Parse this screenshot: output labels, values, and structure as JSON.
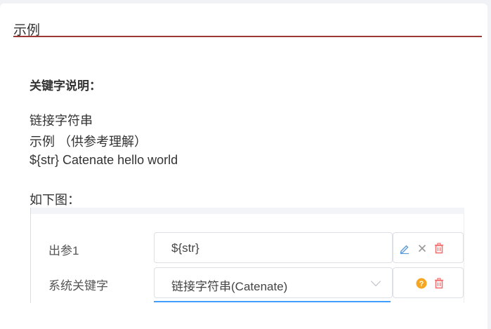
{
  "section": {
    "title": "示例"
  },
  "content": {
    "heading": "关键字说明：",
    "lines": [
      "链接字符串",
      "示例 （供参考理解）",
      "${str} Catenate hello world"
    ],
    "below_label": "如下图："
  },
  "form": {
    "rows": [
      {
        "label": "出参1",
        "value": "${str}",
        "icons": [
          "edit-icon",
          "close-icon",
          "trash-icon"
        ]
      },
      {
        "label": "系统关键字",
        "value": "链接字符串(Catenate)",
        "icons": [
          "help-icon",
          "trash-icon"
        ]
      }
    ]
  },
  "colors": {
    "title_rule": "#9b3a35",
    "focus": "#409eff",
    "edit_icon": "#5b9bd5",
    "delete_icon": "#f56c6c",
    "help_icon": "#f5a623"
  }
}
